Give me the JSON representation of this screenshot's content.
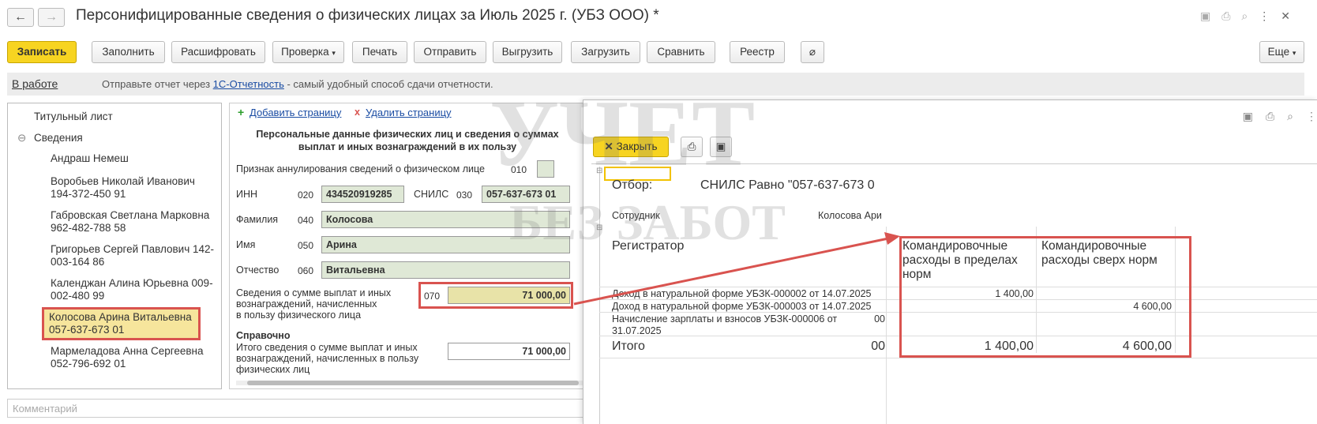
{
  "window": {
    "title": "Персонифицированные сведения о физических лицах за Июль 2025 г. (УБЗ ООО) *"
  },
  "toolbar": {
    "save": "Записать",
    "fill": "Заполнить",
    "decode": "Расшифровать",
    "check": "Проверка",
    "print": "Печать",
    "send": "Отправить",
    "export": "Выгрузить",
    "import": "Загрузить",
    "compare": "Сравнить",
    "registry": "Реестр",
    "more": "Еще"
  },
  "status": {
    "state": "В работе",
    "prefix": "Отправьте отчет через ",
    "link": "1С-Отчетность",
    "suffix": " - самый удобный способ сдачи отчетности."
  },
  "tree": {
    "title_page": "Титульный лист",
    "section": "Сведения",
    "people": [
      {
        "name": "Андраш Немеш",
        "snils": ""
      },
      {
        "name": "Воробьев Николай Иванович",
        "snils": "194-372-450 91"
      },
      {
        "name": "Габровская Светлана Марковна",
        "snils": "962-482-788 58"
      },
      {
        "name": "Григорьев Сергей Павлович 142-",
        "snils": "003-164 86"
      },
      {
        "name": "Календжан Алина Юрьевна 009-",
        "snils": "002-480 99"
      },
      {
        "name": "Колосова Арина Витальевна",
        "snils": "057-637-673 01"
      },
      {
        "name": "Мармеладова Анна Сергеевна",
        "snils": "052-796-692 01"
      }
    ]
  },
  "form": {
    "add_page": "Добавить страницу",
    "delete_page": "Удалить страницу",
    "heading_1": "Персональные данные физических лиц и сведения о суммах",
    "heading_2": "выплат и иных вознаграждений в их пользу",
    "annul_label": "Признак аннулирования сведений о физическом лице",
    "annul_code": "010",
    "inn_label": "ИНН",
    "inn_code": "020",
    "inn_value": "434520919285",
    "snils_label": "СНИЛС",
    "snils_code": "030",
    "snils_value": "057-637-673 01",
    "lastname_label": "Фамилия",
    "lastname_code": "040",
    "lastname_value": "Колосова",
    "firstname_label": "Имя",
    "firstname_code": "050",
    "firstname_value": "Арина",
    "patronymic_label": "Отчество",
    "patronymic_code": "060",
    "patronymic_value": "Витальевна",
    "payments_label_1": "Сведения о сумме выплат и иных",
    "payments_label_2": "вознаграждений, начисленных",
    "payments_label_3": "в пользу физического лица",
    "payments_code": "070",
    "payments_value": "71 000,00",
    "ref_title": "Справочно",
    "ref_label_1": "Итого сведения о сумме выплат и иных",
    "ref_label_2": "вознаграждений, начисленных в пользу",
    "ref_label_3": "физических лиц",
    "ref_value": "71 000,00"
  },
  "comment_placeholder": "Комментарий",
  "report": {
    "close": "Закрыть",
    "filter_label": "Отбор:",
    "filter_value": "СНИЛС Равно \"057-637-673 0",
    "employee_label": "Сотрудник",
    "employee_value": "Колосова Ари",
    "registrar_label": "Регистратор",
    "col1_header_1": "Командировочные",
    "col1_header_2": "расходы в пределах",
    "col1_header_3": "норм",
    "col2_header_1": "Командировочные",
    "col2_header_2": "расходы сверх норм",
    "rows": [
      {
        "doc": "Доход в натуральной форме УБЗК-000002 от 14.07.2025",
        "c0": "",
        "c1": "1 400,00",
        "c2": ""
      },
      {
        "doc": "Доход в натуральной форме УБЗК-000003 от 14.07.2025",
        "c0": "",
        "c1": "",
        "c2": "4 600,00"
      },
      {
        "doc": "Начисление зарплаты и взносов УБЗК-000006 от",
        "doc2": "31.07.2025",
        "c0": "00",
        "c1": "",
        "c2": ""
      }
    ],
    "total_label": "Итого",
    "total_c0": "00",
    "total_c1": "1 400,00",
    "total_c2": "4 600,00"
  },
  "watermark": {
    "line1": "УЧЕТ",
    "line2": "БЕЗ ЗАБОТ"
  }
}
